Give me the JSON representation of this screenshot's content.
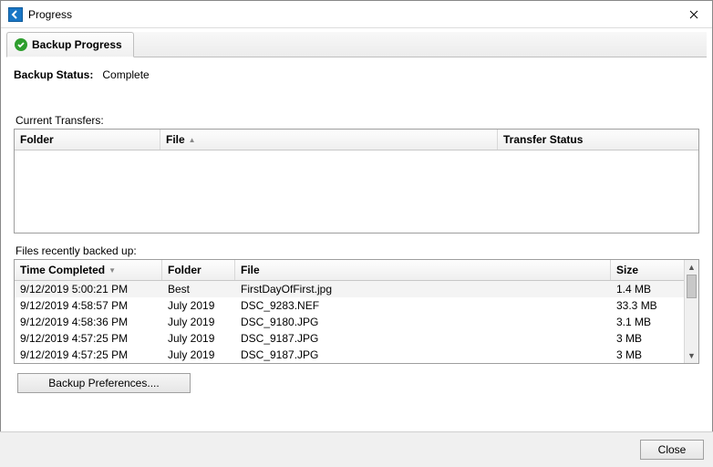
{
  "window": {
    "title": "Progress"
  },
  "tab": {
    "label": "Backup Progress"
  },
  "status": {
    "label": "Backup Status:",
    "value": "Complete"
  },
  "transfers": {
    "section_label": "Current Transfers:",
    "cols": {
      "folder": "Folder",
      "file": "File",
      "status": "Transfer Status"
    }
  },
  "recent": {
    "section_label": "Files recently backed up:",
    "cols": {
      "time": "Time Completed",
      "folder": "Folder",
      "file": "File",
      "size": "Size"
    },
    "rows": [
      {
        "time": "9/12/2019 5:00:21 PM",
        "folder": "Best",
        "file": "FirstDayOfFirst.jpg",
        "size": "1.4 MB"
      },
      {
        "time": "9/12/2019 4:58:57 PM",
        "folder": "July 2019",
        "file": "DSC_9283.NEF",
        "size": "33.3 MB"
      },
      {
        "time": "9/12/2019 4:58:36 PM",
        "folder": "July 2019",
        "file": "DSC_9180.JPG",
        "size": "3.1 MB"
      },
      {
        "time": "9/12/2019 4:57:25 PM",
        "folder": "July 2019",
        "file": "DSC_9187.JPG",
        "size": "3 MB"
      },
      {
        "time": "9/12/2019 4:57:25 PM",
        "folder": "July 2019",
        "file": "DSC_9187.JPG",
        "size": "3 MB"
      }
    ]
  },
  "buttons": {
    "prefs": "Backup Preferences....",
    "close": "Close"
  }
}
